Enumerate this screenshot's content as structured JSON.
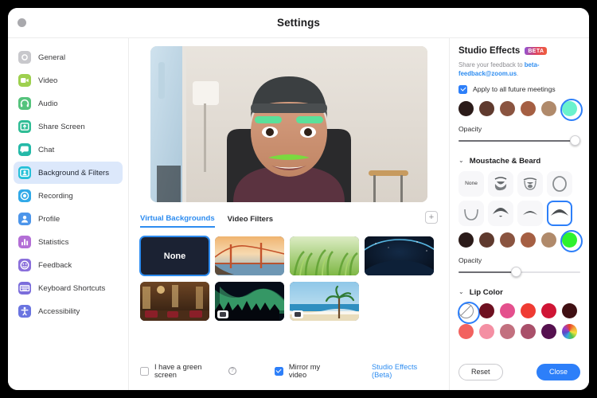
{
  "window": {
    "title": "Settings",
    "traffic_light": "close-button"
  },
  "sidebar": {
    "items": [
      {
        "label": "General",
        "icon": "gear-icon",
        "color": "#c8c8cc",
        "active": false
      },
      {
        "label": "Video",
        "icon": "camera-icon",
        "color": "#9ed04f",
        "active": false
      },
      {
        "label": "Audio",
        "icon": "headphones-icon",
        "color": "#55c37c",
        "active": false
      },
      {
        "label": "Share Screen",
        "icon": "share-icon",
        "color": "#30bd95",
        "active": false
      },
      {
        "label": "Chat",
        "icon": "chat-icon",
        "color": "#24b9a8",
        "active": false
      },
      {
        "label": "Background & Filters",
        "icon": "person-card-icon",
        "color": "#25c0d8",
        "active": true
      },
      {
        "label": "Recording",
        "icon": "record-icon",
        "color": "#31a9e8",
        "active": false
      },
      {
        "label": "Profile",
        "icon": "person-icon",
        "color": "#4c95ea",
        "active": false
      },
      {
        "label": "Statistics",
        "icon": "bar-chart-icon",
        "color": "#b36fd6",
        "active": false
      },
      {
        "label": "Feedback",
        "icon": "smiley-icon",
        "color": "#8a6fdb",
        "active": false
      },
      {
        "label": "Keyboard Shortcuts",
        "icon": "keyboard-icon",
        "color": "#7b6ddb",
        "active": false
      },
      {
        "label": "Accessibility",
        "icon": "accessibility-icon",
        "color": "#6a74e0",
        "active": false
      }
    ]
  },
  "main": {
    "preview_alt": "video-preview-self-view",
    "tabs": [
      {
        "label": "Virtual Backgrounds",
        "active": true
      },
      {
        "label": "Video Filters",
        "active": false
      }
    ],
    "add_button_glyph": "+",
    "backgrounds": [
      {
        "name": "None",
        "selected": true,
        "has_video_badge": false
      },
      {
        "name": "Golden Gate Bridge",
        "selected": false,
        "has_video_badge": false
      },
      {
        "name": "Grass",
        "selected": false,
        "has_video_badge": false
      },
      {
        "name": "Earth from Space",
        "selected": false,
        "has_video_badge": false
      },
      {
        "name": "Hotel Lobby",
        "selected": false,
        "has_video_badge": false
      },
      {
        "name": "Aurora Borealis",
        "selected": false,
        "has_video_badge": true
      },
      {
        "name": "Beach",
        "selected": false,
        "has_video_badge": true
      }
    ],
    "green_screen_label": "I have a green screen",
    "green_screen_checked": false,
    "help_glyph": "?",
    "mirror_label": "Mirror my video",
    "mirror_checked": true,
    "studio_effects_link": "Studio Effects (Beta)"
  },
  "panel": {
    "title": "Studio Effects",
    "beta_badge": "BETA",
    "feedback_prefix": "Share your feedback to ",
    "feedback_email": "beta-feedback@zoom.us",
    "feedback_suffix": ".",
    "apply_label": "Apply to all future meetings",
    "apply_checked": true,
    "eyebrow_colors": [
      "#2b1b19",
      "#5f3a2e",
      "#8a5440",
      "#a55f43",
      "#b08a6b",
      "#6af2cd"
    ],
    "eyebrow_selected_index": 5,
    "opacity_label": "Opacity",
    "eyebrow_opacity": 100,
    "moustache": {
      "section_title": "Moustache & Beard",
      "chevron": "⌄",
      "none_label": "None",
      "styles": [
        {
          "name": "none",
          "selected": false
        },
        {
          "name": "full-beard",
          "selected": false
        },
        {
          "name": "goatee",
          "selected": false
        },
        {
          "name": "circle-beard",
          "selected": false
        },
        {
          "name": "chin-strap",
          "selected": false
        },
        {
          "name": "handlebar",
          "selected": false
        },
        {
          "name": "thin-stache",
          "selected": false
        },
        {
          "name": "chevron-stache",
          "selected": true
        }
      ],
      "colors": [
        "#2b1b19",
        "#5f3a2e",
        "#8a5440",
        "#a55f43",
        "#b08a6b",
        "#2ef22e"
      ],
      "selected_index": 5,
      "opacity_label": "Opacity",
      "opacity": 47
    },
    "lip": {
      "section_title": "Lip Color",
      "chevron": "⌄",
      "colors": [
        {
          "name": "no-color",
          "hex": "none",
          "selected": true
        },
        {
          "name": "dark-maroon",
          "hex": "#6e1020",
          "selected": false
        },
        {
          "name": "hot-pink",
          "hex": "#e4508d",
          "selected": false
        },
        {
          "name": "red-orange",
          "hex": "#ef3b33",
          "selected": false
        },
        {
          "name": "crimson",
          "hex": "#cf1535",
          "selected": false
        },
        {
          "name": "dark-brown",
          "hex": "#401013",
          "selected": false
        },
        {
          "name": "coral",
          "hex": "#f2625f",
          "selected": false
        },
        {
          "name": "light-pink",
          "hex": "#f48fa3",
          "selected": false
        },
        {
          "name": "dusty-rose",
          "hex": "#c2707f",
          "selected": false
        },
        {
          "name": "mauve",
          "hex": "#a9506a",
          "selected": false
        },
        {
          "name": "deep-purple",
          "hex": "#55114f",
          "selected": false
        },
        {
          "name": "rainbow",
          "hex": "rainbow",
          "selected": false
        }
      ]
    },
    "reset_label": "Reset",
    "close_label": "Close"
  },
  "colors": {
    "accent": "#2d7ff9",
    "link": "#2d8cf0",
    "active_nav_bg": "#dce8fb"
  }
}
